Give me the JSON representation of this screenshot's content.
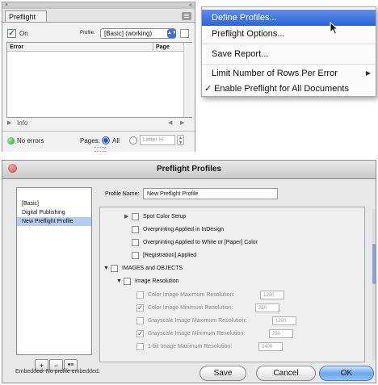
{
  "panel": {
    "close_mark": "×",
    "collapse_mark": "«",
    "tab_label": "Preflight",
    "on_label": "On",
    "profile_label": "Profile:",
    "profile_value": "[Basic] (working)",
    "columns": {
      "error": "Error",
      "page": "Page"
    },
    "info_label": "Info",
    "status_text": "No errors",
    "pages_label": "Pages:",
    "pages_all": "All",
    "pages_range_placeholder": "Letter H"
  },
  "menu": {
    "items": [
      {
        "label": "Define Profiles...",
        "highlighted": true
      },
      {
        "label": "Preflight Options..."
      },
      {
        "label": "Save Report..."
      },
      {
        "label": "Limit Number of Rows Per Error",
        "submenu": true
      },
      {
        "label": "Enable Preflight for All Documents",
        "checked": true
      }
    ],
    "check_mark": "✓",
    "submenu_mark": "▶"
  },
  "dialog": {
    "title": "Preflight Profiles",
    "profiles": [
      "[Basic]",
      "Digital Publishing",
      "New Preflight Profile"
    ],
    "selected_profile_index": 2,
    "profile_name_label": "Profile Name:",
    "profile_name_value": "New Preflight Profile",
    "tree": {
      "spot_color_setup": "Spot Color Setup",
      "overprinting_indesign": "Overprinting Applied in InDesign",
      "overprinting_white": "Overprinting Applied to White or [Paper] Color",
      "registration": "[Registration] Applied",
      "images_and_objects": "IMAGES and OBJECTS",
      "image_resolution": "Image Resolution",
      "color_max": {
        "label": "Color Image Maximum Resolution:",
        "value": "1200",
        "checked": false
      },
      "color_min": {
        "label": "Color Image Minimum Resolution:",
        "value": "250",
        "checked": true
      },
      "gray_max": {
        "label": "Grayscale Image Maximum Resolution:",
        "value": "1200",
        "checked": false
      },
      "gray_min": {
        "label": "Grayscale Image Minimum Resolution:",
        "value": "250",
        "checked": true
      },
      "onebit_max": {
        "label": "1-bit Image Maximum Resolution:",
        "value": "2400",
        "checked": false
      }
    },
    "buttons": {
      "add": "+",
      "remove": "−",
      "menu": "▾≡",
      "save": "Save",
      "cancel": "Cancel",
      "ok": "OK"
    },
    "footer_text": "Embedded: No profile embedded."
  },
  "colors": {
    "menu_highlight": "#2c63d8",
    "status_green": "#1c9c1c",
    "default_button": "#6aa8ee",
    "selection": "#b6cdf2"
  }
}
